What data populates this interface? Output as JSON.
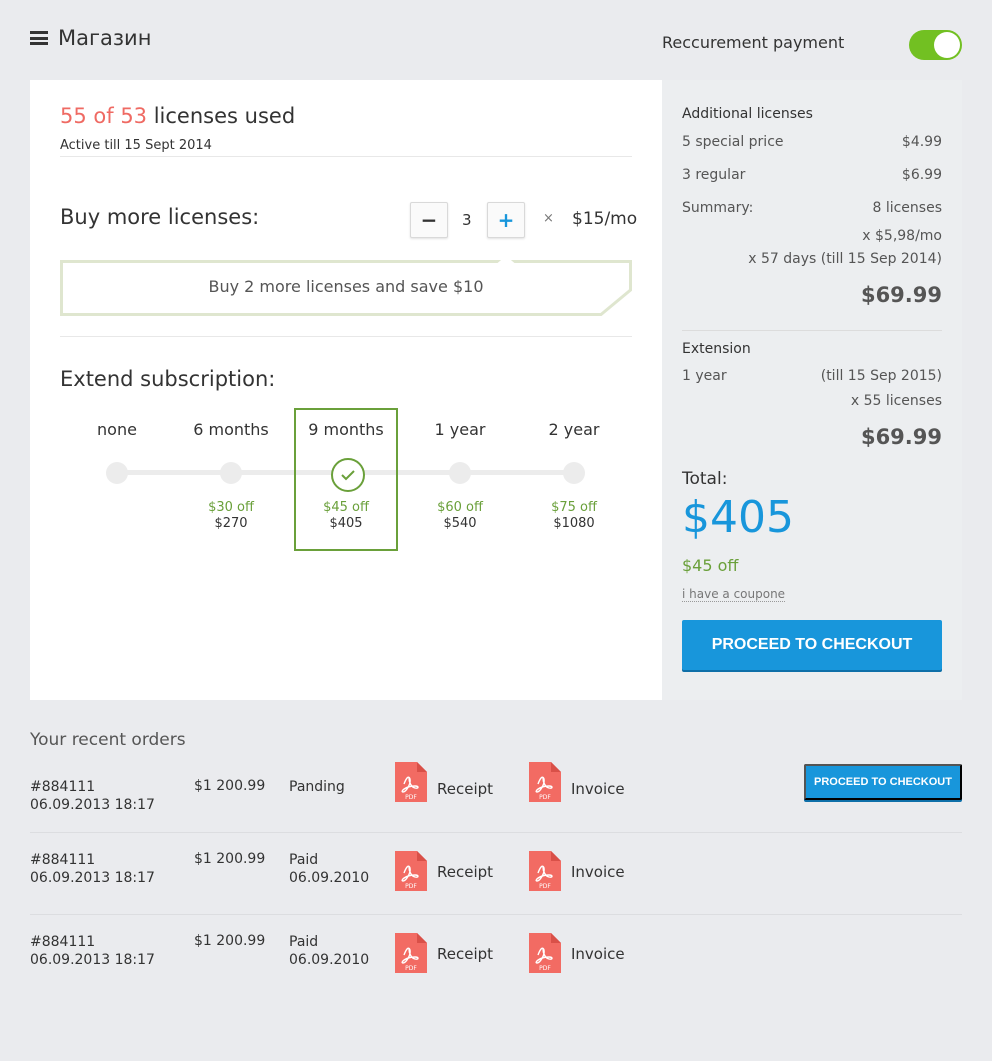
{
  "header": {
    "title": "Магазин",
    "recurrent_label": "Reccurement payment",
    "recurrent_on": true
  },
  "licenses": {
    "used_red": "55 of 53",
    "used_rest": " licenses used",
    "active_till": "Active till 15 Sept 2014",
    "buy_more_label": "Buy more licenses:",
    "quantity": "3",
    "times": "×",
    "price_per_month": "$15/mo",
    "save_message": "Buy 2 more licenses and save $10"
  },
  "subscription": {
    "label": "Extend subscription:",
    "options": [
      {
        "label": "none",
        "off": "",
        "price": ""
      },
      {
        "label": "6 months",
        "off": "$30 off",
        "price": "$270"
      },
      {
        "label": "9 months",
        "off": "$45 off",
        "price": "$405",
        "selected": true
      },
      {
        "label": "1 year",
        "off": "$60 off",
        "price": "$540"
      },
      {
        "label": "2 year",
        "off": "$75 off",
        "price": "$1080"
      }
    ]
  },
  "summary": {
    "additional_title": "Additional licenses",
    "special_label": "5 special price",
    "special_price": "$4.99",
    "regular_label": "3 regular",
    "regular_price": "$6.99",
    "summary_label": "Summary:",
    "summary_licenses": "8 licenses",
    "per_month": "x $5,98/mo",
    "days": "x 57 days (till 15 Sep 2014)",
    "additional_total": "$69.99",
    "extension_title": "Extension",
    "extension_period": "1 year",
    "extension_till": "(till 15 Sep 2015)",
    "extension_licenses": "x 55 licenses",
    "extension_total": "$69.99",
    "total_label": "Total:",
    "total_amount": "$405",
    "total_off": "$45 off",
    "coupon_link": "i have a coupone",
    "checkout": "PROCEED TO CHECKOUT"
  },
  "orders": {
    "title": "Your recent orders",
    "receipt_label": "Receipt",
    "invoice_label": "Invoice",
    "pdf_text": "PDF",
    "checkout_small": "PROCEED TO CHECKOUT",
    "rows": [
      {
        "id": "#884111",
        "datetime": "06.09.2013 18:17",
        "amount": "$1 200.99",
        "status": "Panding",
        "status_date": ""
      },
      {
        "id": "#884111",
        "datetime": "06.09.2013 18:17",
        "amount": "$1 200.99",
        "status": "Paid",
        "status_date": "06.09.2010"
      },
      {
        "id": "#884111",
        "datetime": "06.09.2013 18:17",
        "amount": "$1 200.99",
        "status": "Paid",
        "status_date": "06.09.2010"
      }
    ]
  },
  "colors": {
    "accent": "#1896db",
    "green": "#6aa03a",
    "red": "#ef6a63",
    "toggle": "#72c022",
    "pdf": "#f26b63"
  }
}
